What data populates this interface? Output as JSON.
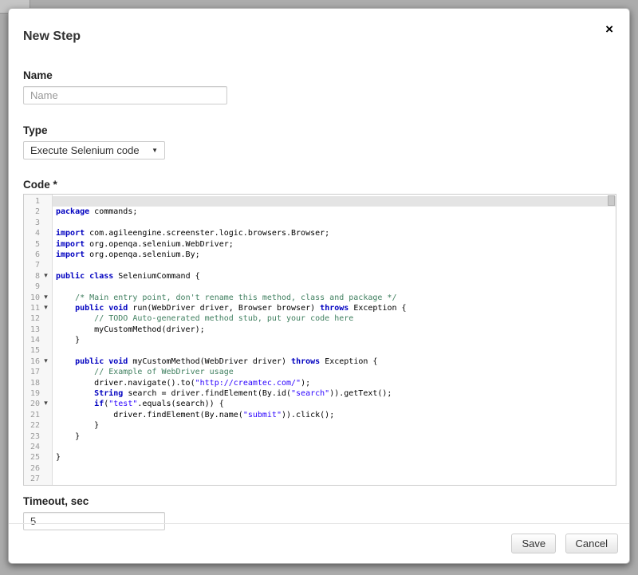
{
  "modal": {
    "title": "New Step",
    "close_icon": "×"
  },
  "form": {
    "name": {
      "label": "Name",
      "placeholder": "Name",
      "value": ""
    },
    "type": {
      "label": "Type",
      "value": "Execute Selenium code",
      "caret": "▼"
    },
    "code": {
      "label": "Code *"
    },
    "timeout": {
      "label": "Timeout, sec",
      "value": "5"
    }
  },
  "footer": {
    "save_label": "Save",
    "cancel_label": "Cancel"
  },
  "editor": {
    "active_line": 1,
    "fold_icon": "▾",
    "fold_lines": [
      8,
      10,
      11,
      16,
      20
    ],
    "colors": {
      "keyword": "#0000c0",
      "comment": "#3f7f5f",
      "string": "#2a00ff",
      "plain": "#000000",
      "line_number": "#999999",
      "active_line_bg": "#e4e4e4"
    },
    "lines": [
      {
        "n": 1,
        "segs": []
      },
      {
        "n": 2,
        "segs": [
          [
            "k",
            "package"
          ],
          [
            "p",
            " commands;"
          ]
        ]
      },
      {
        "n": 3,
        "segs": []
      },
      {
        "n": 4,
        "segs": [
          [
            "k",
            "import"
          ],
          [
            "p",
            " com.agileengine.screenster.logic.browsers.Browser;"
          ]
        ]
      },
      {
        "n": 5,
        "segs": [
          [
            "k",
            "import"
          ],
          [
            "p",
            " org.openqa.selenium.WebDriver;"
          ]
        ]
      },
      {
        "n": 6,
        "segs": [
          [
            "k",
            "import"
          ],
          [
            "p",
            " org.openqa.selenium.By;"
          ]
        ]
      },
      {
        "n": 7,
        "segs": []
      },
      {
        "n": 8,
        "segs": [
          [
            "k",
            "public"
          ],
          [
            "p",
            " "
          ],
          [
            "k",
            "class"
          ],
          [
            "p",
            " SeleniumCommand {"
          ]
        ]
      },
      {
        "n": 9,
        "segs": []
      },
      {
        "n": 10,
        "segs": [
          [
            "p",
            "    "
          ],
          [
            "c",
            "/* Main entry point, don't rename this method, class and package */"
          ]
        ]
      },
      {
        "n": 11,
        "segs": [
          [
            "p",
            "    "
          ],
          [
            "k",
            "public"
          ],
          [
            "p",
            " "
          ],
          [
            "k",
            "void"
          ],
          [
            "p",
            " run(WebDriver driver, Browser browser) "
          ],
          [
            "k",
            "throws"
          ],
          [
            "p",
            " Exception {"
          ]
        ]
      },
      {
        "n": 12,
        "segs": [
          [
            "p",
            "        "
          ],
          [
            "c",
            "// TODO Auto-generated method stub, put your code here"
          ]
        ]
      },
      {
        "n": 13,
        "segs": [
          [
            "p",
            "        myCustomMethod(driver);"
          ]
        ]
      },
      {
        "n": 14,
        "segs": [
          [
            "p",
            "    }"
          ]
        ]
      },
      {
        "n": 15,
        "segs": []
      },
      {
        "n": 16,
        "segs": [
          [
            "p",
            "    "
          ],
          [
            "k",
            "public"
          ],
          [
            "p",
            " "
          ],
          [
            "k",
            "void"
          ],
          [
            "p",
            " myCustomMethod(WebDriver driver) "
          ],
          [
            "k",
            "throws"
          ],
          [
            "p",
            " Exception {"
          ]
        ]
      },
      {
        "n": 17,
        "segs": [
          [
            "p",
            "        "
          ],
          [
            "c",
            "// Example of WebDriver usage"
          ]
        ]
      },
      {
        "n": 18,
        "segs": [
          [
            "p",
            "        driver.navigate().to("
          ],
          [
            "s",
            "\"http://creamtec.com/\""
          ],
          [
            "p",
            ");"
          ]
        ]
      },
      {
        "n": 19,
        "segs": [
          [
            "p",
            "        "
          ],
          [
            "k",
            "String"
          ],
          [
            "p",
            " search = driver.findElement(By.id("
          ],
          [
            "s",
            "\"search\""
          ],
          [
            "p",
            ")).getText();"
          ]
        ]
      },
      {
        "n": 20,
        "segs": [
          [
            "p",
            "        "
          ],
          [
            "k",
            "if"
          ],
          [
            "p",
            "("
          ],
          [
            "s",
            "\"test\""
          ],
          [
            "p",
            ".equals(search)) {"
          ]
        ]
      },
      {
        "n": 21,
        "segs": [
          [
            "p",
            "            driver.findElement(By.name("
          ],
          [
            "s",
            "\"submit\""
          ],
          [
            "p",
            ")).click();"
          ]
        ]
      },
      {
        "n": 22,
        "segs": [
          [
            "p",
            "        }"
          ]
        ]
      },
      {
        "n": 23,
        "segs": [
          [
            "p",
            "    }"
          ]
        ]
      },
      {
        "n": 24,
        "segs": []
      },
      {
        "n": 25,
        "segs": [
          [
            "p",
            "}"
          ]
        ]
      },
      {
        "n": 26,
        "segs": []
      },
      {
        "n": 27,
        "segs": []
      }
    ]
  }
}
